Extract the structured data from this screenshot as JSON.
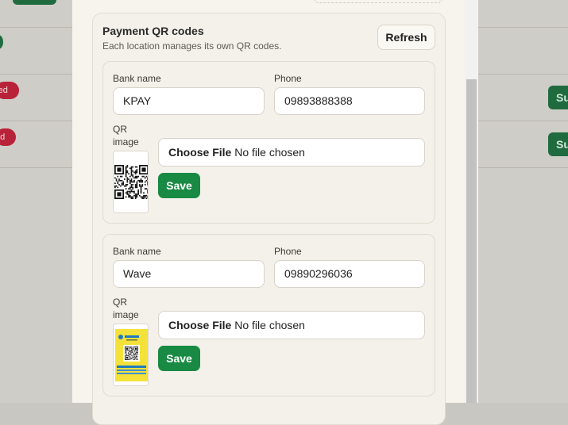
{
  "background": {
    "status_pill_1": "red",
    "status_pill_2": "ed",
    "action_button_1": "Su",
    "action_button_2": "Su"
  },
  "modal": {
    "section": {
      "title": "Payment QR codes",
      "subtitle": "Each location manages its own QR codes.",
      "refresh_label": "Refresh"
    },
    "cards": [
      {
        "bank_label": "Bank name",
        "bank_value": "KPAY",
        "phone_label": "Phone",
        "phone_value": "09893888388",
        "qr_label": "QR image",
        "choose_file_label": "Choose File",
        "no_file_text": "No file chosen",
        "save_label": "Save"
      },
      {
        "bank_label": "Bank name",
        "bank_value": "Wave",
        "phone_label": "Phone",
        "phone_value": "09890296036",
        "qr_label": "QR image",
        "choose_file_label": "Choose File",
        "no_file_text": "No file chosen",
        "save_label": "Save"
      }
    ]
  },
  "colors": {
    "primary_green": "#188a43",
    "badge_red": "#b8233a",
    "modal_bg": "#f7f4ee"
  }
}
